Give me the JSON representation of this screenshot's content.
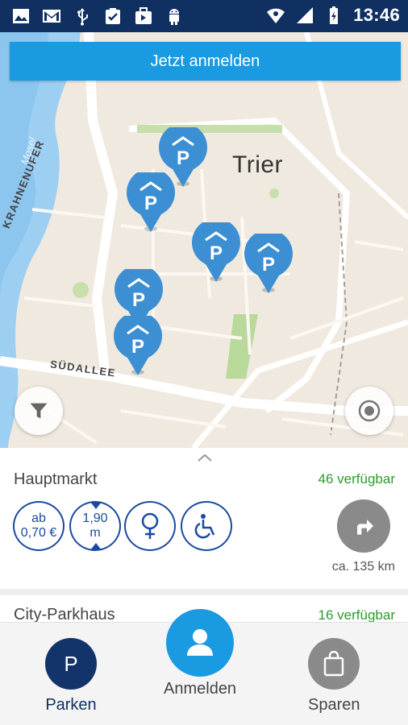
{
  "status_bar": {
    "time": "13:46",
    "left_icons": [
      "image-icon",
      "gmail-icon",
      "usb-icon",
      "clipboard-check-icon",
      "briefcase-icon",
      "android-icon"
    ],
    "right_icons": [
      "wifi-icon",
      "signal-icon",
      "battery-icon"
    ]
  },
  "map": {
    "login_banner": "Jetzt anmelden",
    "city_label": "Trier",
    "road_labels": [
      "KRAHNENUFER",
      "SÜDALLEE"
    ],
    "river_label": "Mosel",
    "parking_pins": [
      {
        "label": "P"
      },
      {
        "label": "P"
      },
      {
        "label": "P"
      },
      {
        "label": "P"
      },
      {
        "label": "P"
      },
      {
        "label": "P"
      }
    ]
  },
  "sheet": {
    "card1": {
      "title": "Hauptmarkt",
      "availability": "46 verfügbar",
      "price_line1": "ab",
      "price_line2": "0,70 €",
      "height_line1": "1,90",
      "height_line2": "m",
      "distance": "ca. 135 km"
    },
    "card2": {
      "title": "City-Parkhaus",
      "availability": "16 verfügbar"
    }
  },
  "bottom_nav": {
    "parken": {
      "label": "Parken",
      "icon_text": "P"
    },
    "anmelden": {
      "label": "Anmelden"
    },
    "sparen": {
      "label": "Sparen"
    }
  },
  "colors": {
    "status_bar": "#113062",
    "accent_blue": "#1a9ae0",
    "pin_blue": "#3d8fd3",
    "dark_blue": "#1a4aa0",
    "available_green": "#2e9a2e"
  }
}
